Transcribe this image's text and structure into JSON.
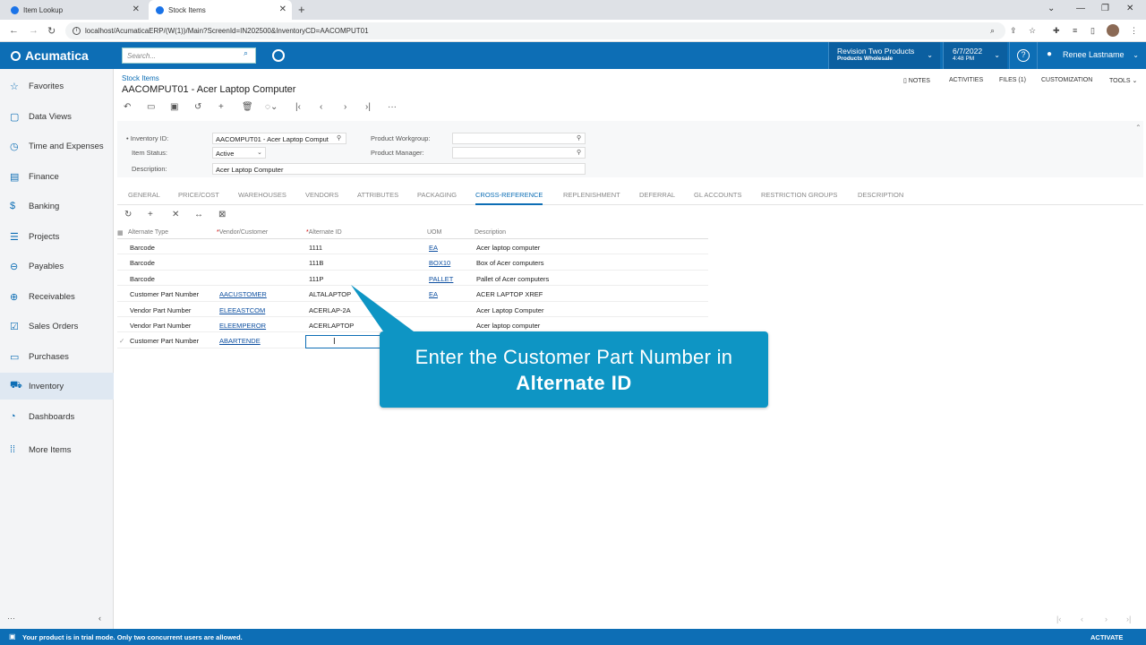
{
  "browser": {
    "tabs": [
      {
        "label": "Item Lookup"
      },
      {
        "label": "Stock Items"
      }
    ],
    "url": "localhost/AcumaticaERP/(W(1))/Main?ScreenId=IN202500&InventoryCD=AACOMPUT01"
  },
  "header": {
    "logo": "Acumatica",
    "search_placeholder": "Search...",
    "branch_title": "Revision Two Products",
    "branch_subtitle": "Products Wholesale",
    "date": "6/7/2022",
    "time": "4:48 PM",
    "user": "Renee Lastname"
  },
  "sidebar": {
    "items": [
      {
        "label": "Favorites",
        "icon": "star-icon"
      },
      {
        "label": "Data Views",
        "icon": "data-views-icon"
      },
      {
        "label": "Time and Expenses",
        "icon": "clock-icon"
      },
      {
        "label": "Finance",
        "icon": "calculator-icon"
      },
      {
        "label": "Banking",
        "icon": "dollar-icon"
      },
      {
        "label": "Projects",
        "icon": "projects-icon"
      },
      {
        "label": "Payables",
        "icon": "minus-circle-icon"
      },
      {
        "label": "Receivables",
        "icon": "plus-circle-icon"
      },
      {
        "label": "Sales Orders",
        "icon": "sales-orders-icon"
      },
      {
        "label": "Purchases",
        "icon": "purchases-icon"
      },
      {
        "label": "Inventory",
        "icon": "truck-icon"
      },
      {
        "label": "Dashboards",
        "icon": "dashboard-icon"
      },
      {
        "label": "More Items",
        "icon": "grid-dots-icon"
      }
    ]
  },
  "page": {
    "breadcrumb": "Stock Items",
    "title": "AACOMPUT01 - Acer Laptop Computer",
    "top_links": [
      "NOTES",
      "ACTIVITIES",
      "FILES (1)",
      "CUSTOMIZATION",
      "TOOLS"
    ]
  },
  "form": {
    "inventory_id_label": "Inventory ID:",
    "inventory_id_value": "AACOMPUT01 - Acer Laptop Comput",
    "item_status_label": "Item Status:",
    "item_status_value": "Active",
    "description_label": "Description:",
    "description_value": "Acer Laptop Computer",
    "product_workgroup_label": "Product Workgroup:",
    "product_manager_label": "Product Manager:"
  },
  "tabs": [
    "GENERAL",
    "PRICE/COST",
    "WAREHOUSES",
    "VENDORS",
    "ATTRIBUTES",
    "PACKAGING",
    "CROSS-REFERENCE",
    "REPLENISHMENT",
    "DEFERRAL",
    "GL ACCOUNTS",
    "RESTRICTION GROUPS",
    "DESCRIPTION"
  ],
  "grid": {
    "columns": [
      "Alternate Type",
      "Vendor/Customer",
      "Alternate ID",
      "UOM",
      "Description"
    ],
    "rows": [
      {
        "type": "Barcode",
        "vendor": "",
        "alt_id": "1111",
        "uom": "EA",
        "desc": "Acer laptop computer"
      },
      {
        "type": "Barcode",
        "vendor": "",
        "alt_id": "111B",
        "uom": "BOX10",
        "desc": "Box of Acer computers"
      },
      {
        "type": "Barcode",
        "vendor": "",
        "alt_id": "111P",
        "uom": "PALLET",
        "desc": "Pallet of Acer computers"
      },
      {
        "type": "Customer Part Number",
        "vendor": "AACUSTOMER",
        "alt_id": "ALTALAPTOP",
        "uom": "EA",
        "desc": "ACER LAPTOP XREF"
      },
      {
        "type": "Vendor Part Number",
        "vendor": "ELEEASTCOM",
        "alt_id": "ACERLAP-2A",
        "uom": "",
        "desc": "Acer Laptop Computer"
      },
      {
        "type": "Vendor Part Number",
        "vendor": "ELEEMPEROR",
        "alt_id": "ACERLAPTOP",
        "uom": "",
        "desc": "Acer laptop computer"
      },
      {
        "type": "Customer Part Number",
        "vendor": "ABARTENDE",
        "alt_id": "",
        "uom": "",
        "desc": ""
      }
    ]
  },
  "callout": {
    "line1": "Enter the Customer Part Number in",
    "line2": "Alternate ID"
  },
  "status": {
    "message": "Your product is in trial mode. Only two concurrent users are allowed.",
    "action": "ACTIVATE"
  },
  "colors": {
    "brand": "#0d6eb5",
    "callout": "#0e95c4"
  }
}
